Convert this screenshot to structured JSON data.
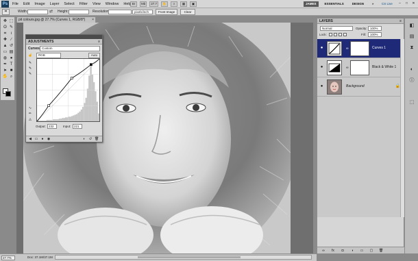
{
  "menubar": {
    "logo": "Ps",
    "items": [
      "File",
      "Edit",
      "Image",
      "Layer",
      "Select",
      "Filter",
      "View",
      "Window",
      "Help"
    ],
    "zoom": "27.7",
    "workspaces": [
      "JAMES",
      "ESSENTIALS",
      "DESIGN",
      "»"
    ],
    "cslive": "CS Live",
    "window_controls": [
      "–",
      "□",
      "✕"
    ]
  },
  "options": {
    "width_label": "Width:",
    "height_label": "Height:",
    "swap_icon": "⇄",
    "resolution_label": "Resolution:",
    "resolution_unit": "pixels/inch",
    "front_image": "Front Image",
    "clear": "Clear"
  },
  "tools": [
    "move",
    "marquee",
    "lasso",
    "quick-select",
    "crop",
    "eyedropper",
    "healing",
    "brush",
    "stamp",
    "history-brush",
    "eraser",
    "gradient",
    "blur",
    "dodge",
    "pen",
    "type",
    "path-select",
    "shape",
    "hand",
    "zoom"
  ],
  "document": {
    "tab_title": "pit colours.jpg @ 27.7% (Curves 1, RGB/8*)",
    "close": "×",
    "zoom": "27.7%",
    "doc_size": "Doc: 37.1M/37.1M",
    "photo_colors": {
      "skin": "#d9d9d9",
      "fur": "#9a9a9a",
      "bg": "#c4c4c4"
    }
  },
  "adjustments": {
    "title": "ADJUSTMENTS",
    "menu": "≡",
    "type": "Curves",
    "preset": "Custom",
    "channel": "RGB",
    "auto": "Auto",
    "output_label": "Output:",
    "output_value": "232",
    "input_label": "Input:",
    "input_value": "221",
    "curve_points": [
      [
        0,
        0
      ],
      [
        48,
        64
      ],
      [
        142,
        176
      ],
      [
        221,
        232
      ],
      [
        255,
        255
      ]
    ],
    "histogram": [
      2,
      1,
      1,
      1,
      1,
      1,
      2,
      2,
      2,
      2,
      3,
      3,
      3,
      3,
      4,
      4,
      5,
      5,
      6,
      6,
      7,
      7,
      8,
      9,
      10,
      11,
      13,
      15,
      18,
      22,
      28,
      36,
      50,
      70,
      88,
      72,
      60,
      46,
      30,
      12
    ]
  },
  "layers": {
    "title": "LAYERS",
    "menu": "≡",
    "blend_mode": "Normal",
    "opacity_label": "Opacity:",
    "opacity": "100%",
    "lock_label": "Lock:",
    "fill_label": "Fill:",
    "fill": "100%",
    "items": [
      {
        "name": "Curves 1",
        "selected": true,
        "kind": "adjustment"
      },
      {
        "name": "Black & White 1",
        "selected": false,
        "kind": "adjustment"
      },
      {
        "name": "Background",
        "selected": false,
        "kind": "image"
      }
    ],
    "bottom_icons": [
      "link",
      "fx",
      "mask",
      "adjustment",
      "folder",
      "new-layer",
      "trash"
    ]
  },
  "dock": [
    "layers-icon",
    "channels-icon",
    "history-icon",
    "adjustments-icon",
    "info-icon",
    "navigator-icon"
  ]
}
